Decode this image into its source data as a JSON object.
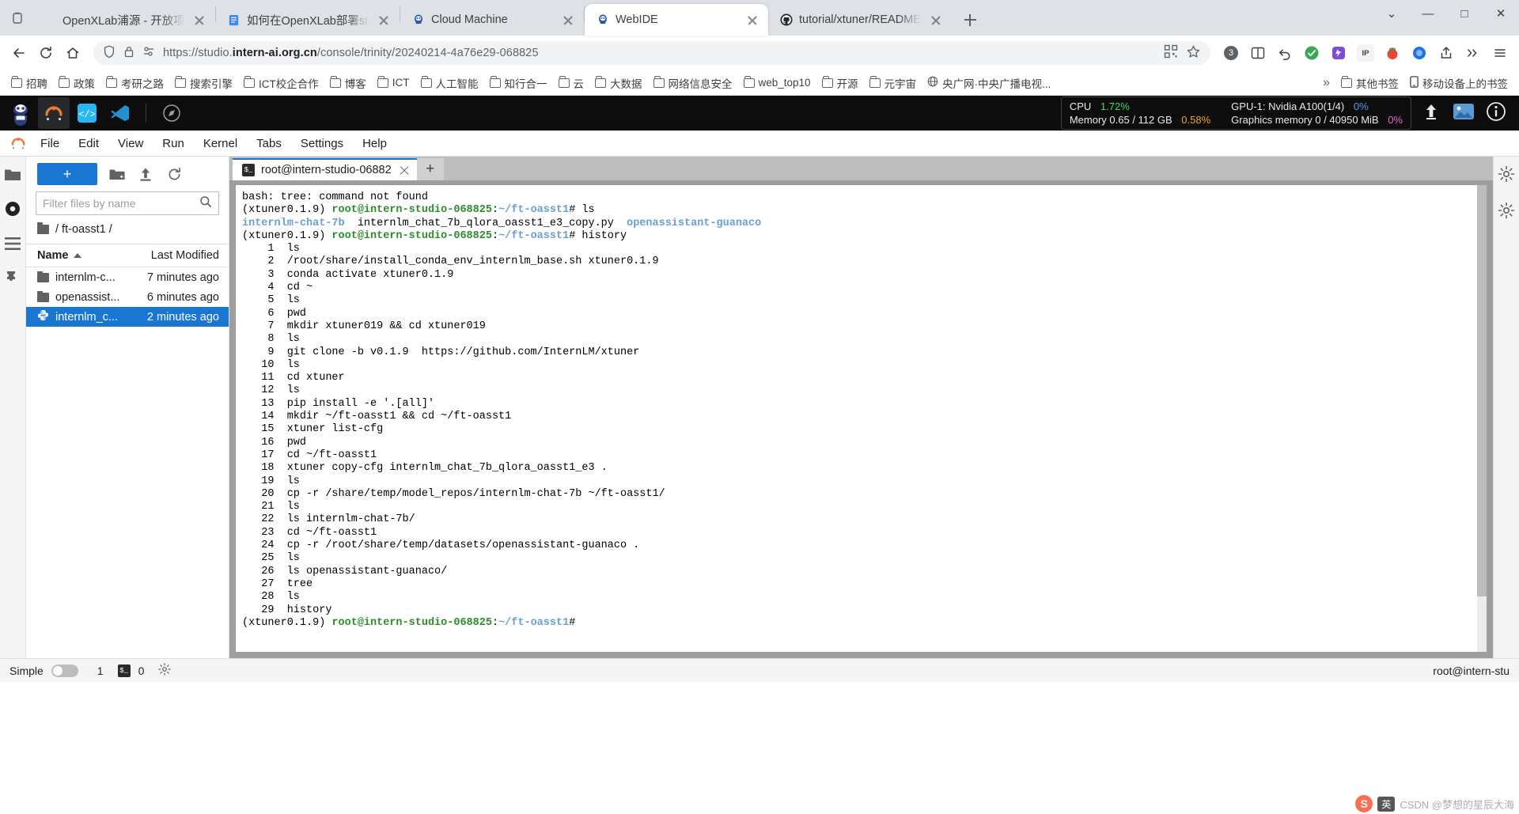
{
  "browser": {
    "tabs": [
      {
        "title": "OpenXLab浦源 - 开放项目",
        "favicon": "none",
        "active": false
      },
      {
        "title": "如何在OpenXLab部署streamli",
        "favicon": "doc-icon",
        "active": false
      },
      {
        "title": "Cloud Machine",
        "favicon": "intern-icon",
        "active": false
      },
      {
        "title": "WebIDE",
        "favicon": "intern-icon",
        "active": true
      },
      {
        "title": "tutorial/xtuner/README.md a",
        "favicon": "github-icon",
        "active": false
      }
    ],
    "new_tab_label": "+",
    "window_controls": {
      "minimize": "—",
      "maximize": "□",
      "close": "✕",
      "tab_search": "⌄"
    },
    "nav": {
      "back": "←",
      "forward": "→",
      "reload": "↻",
      "home": "⌂"
    },
    "omnibox": {
      "url_scheme": "https://studio.",
      "url_domain": "intern-ai.org.cn",
      "url_path": "/console/trinity/20240214-4a76e29-068825",
      "url_full": "https://studio.intern-ai.org.cn/console/trinity/20240214-4a76e29-068825",
      "shield_icon": "shield-icon",
      "lock_icon": "lock-icon",
      "settings_icon": "site-settings-icon",
      "qr_icon": "qr-code-icon",
      "star_icon": "bookmark-star-icon"
    },
    "toolbar_right": {
      "extension_count": "3",
      "split_icon": "split-screen-icon",
      "undo_icon": "undo-icon",
      "ext1": "green-shield-ext",
      "ext2": "purple-ext",
      "ip_label": "IP",
      "ext3": "tomato-ext",
      "ext4": "blue-circle-ext",
      "share_icon": "share-icon",
      "more_icon": "chevron-more-icon",
      "menu_icon": "browser-menu-icon"
    },
    "bookmarks": [
      {
        "label": "招聘",
        "icon": "folder-icon"
      },
      {
        "label": "政策",
        "icon": "folder-icon"
      },
      {
        "label": "考研之路",
        "icon": "folder-icon"
      },
      {
        "label": "搜索引擎",
        "icon": "folder-icon"
      },
      {
        "label": "ICT校企合作",
        "icon": "folder-icon"
      },
      {
        "label": "博客",
        "icon": "folder-icon"
      },
      {
        "label": "ICT",
        "icon": "folder-icon"
      },
      {
        "label": "人工智能",
        "icon": "folder-icon"
      },
      {
        "label": "知行合一",
        "icon": "folder-icon"
      },
      {
        "label": "云",
        "icon": "folder-icon"
      },
      {
        "label": "大数据",
        "icon": "folder-icon"
      },
      {
        "label": "网络信息安全",
        "icon": "folder-icon"
      },
      {
        "label": "web_top10",
        "icon": "folder-icon"
      },
      {
        "label": "开源",
        "icon": "folder-icon"
      },
      {
        "label": "元宇宙",
        "icon": "folder-icon"
      },
      {
        "label": "央广网·中央广播电视...",
        "icon": "globe-icon"
      }
    ],
    "bookmarks_overflow": {
      "chevron": "»",
      "other_bookmarks": "其他书签",
      "mobile_bookmarks": "移动设备上的书签"
    }
  },
  "jupyter": {
    "topbar": {
      "apps": [
        "jupyter-logo",
        "intern-studio-icon",
        "code-server-icon",
        "vscode-icon",
        "compass-icon"
      ],
      "resources": {
        "cpu_label": "CPU",
        "cpu_value": "1.72%",
        "memory_label": "Memory 0.65 / 112 GB",
        "memory_value": "0.58%",
        "gpu_label": "GPU-1: Nvidia A100(1/4)",
        "gpu_value": "0%",
        "gmem_label": "Graphics memory 0 / 40950 MiB",
        "gmem_value": "0%"
      },
      "right_icons": [
        "upload-icon",
        "image-icon",
        "info-icon"
      ]
    },
    "menubar": [
      "File",
      "Edit",
      "View",
      "Run",
      "Kernel",
      "Tabs",
      "Settings",
      "Help"
    ],
    "file_browser": {
      "new_button": "+",
      "tools": [
        "new-folder-icon",
        "upload-icon",
        "refresh-icon"
      ],
      "filter_placeholder": "Filter files by name",
      "filter_value": "",
      "breadcrumb": "/ ft-oasst1 /",
      "columns": {
        "name": "Name",
        "modified": "Last Modified"
      },
      "rows": [
        {
          "name": "internlm-c...",
          "modified": "7 minutes ago",
          "icon": "folder-icon",
          "selected": false
        },
        {
          "name": "openassist...",
          "modified": "6 minutes ago",
          "icon": "folder-icon",
          "selected": false
        },
        {
          "name": "internlm_c...",
          "modified": "2 minutes ago",
          "icon": "python-icon",
          "selected": true
        }
      ]
    },
    "terminal": {
      "tab_title": "root@intern-studio-06882",
      "tab_icon": "terminal-icon",
      "add_tab": "+",
      "lines": [
        [
          {
            "t": "bash: tree: command not found",
            "c": "plain"
          }
        ],
        [
          {
            "t": "(xtuner0.1.9) ",
            "c": "plain"
          },
          {
            "t": "root@intern-studio-068825",
            "c": "green"
          },
          {
            "t": ":",
            "c": "plain"
          },
          {
            "t": "~/ft-oasst1",
            "c": "blue"
          },
          {
            "t": "# ls",
            "c": "plain"
          }
        ],
        [
          {
            "t": "internlm-chat-7b",
            "c": "blue"
          },
          {
            "t": "  internlm_chat_7b_qlora_oasst1_e3_copy.py  ",
            "c": "plain"
          },
          {
            "t": "openassistant-guanaco",
            "c": "blue"
          }
        ],
        [
          {
            "t": "(xtuner0.1.9) ",
            "c": "plain"
          },
          {
            "t": "root@intern-studio-068825",
            "c": "green"
          },
          {
            "t": ":",
            "c": "plain"
          },
          {
            "t": "~/ft-oasst1",
            "c": "blue"
          },
          {
            "t": "# history",
            "c": "plain"
          }
        ],
        [
          {
            "t": "    1  ls",
            "c": "plain"
          }
        ],
        [
          {
            "t": "    2  /root/share/install_conda_env_internlm_base.sh xtuner0.1.9",
            "c": "plain"
          }
        ],
        [
          {
            "t": "    3  conda activate xtuner0.1.9",
            "c": "plain"
          }
        ],
        [
          {
            "t": "    4  cd ~",
            "c": "plain"
          }
        ],
        [
          {
            "t": "    5  ls",
            "c": "plain"
          }
        ],
        [
          {
            "t": "    6  pwd",
            "c": "plain"
          }
        ],
        [
          {
            "t": "    7  mkdir xtuner019 && cd xtuner019",
            "c": "plain"
          }
        ],
        [
          {
            "t": "    8  ls",
            "c": "plain"
          }
        ],
        [
          {
            "t": "    9  git clone -b v0.1.9  https://github.com/InternLM/xtuner",
            "c": "plain"
          }
        ],
        [
          {
            "t": "   10  ls",
            "c": "plain"
          }
        ],
        [
          {
            "t": "   11  cd xtuner",
            "c": "plain"
          }
        ],
        [
          {
            "t": "   12  ls",
            "c": "plain"
          }
        ],
        [
          {
            "t": "   13  pip install -e '.[all]'",
            "c": "plain"
          }
        ],
        [
          {
            "t": "   14  mkdir ~/ft-oasst1 && cd ~/ft-oasst1",
            "c": "plain"
          }
        ],
        [
          {
            "t": "   15  xtuner list-cfg",
            "c": "plain"
          }
        ],
        [
          {
            "t": "   16  pwd",
            "c": "plain"
          }
        ],
        [
          {
            "t": "   17  cd ~/ft-oasst1",
            "c": "plain"
          }
        ],
        [
          {
            "t": "   18  xtuner copy-cfg internlm_chat_7b_qlora_oasst1_e3 .",
            "c": "plain"
          }
        ],
        [
          {
            "t": "   19  ls",
            "c": "plain"
          }
        ],
        [
          {
            "t": "   20  cp -r /share/temp/model_repos/internlm-chat-7b ~/ft-oasst1/",
            "c": "plain"
          }
        ],
        [
          {
            "t": "   21  ls",
            "c": "plain"
          }
        ],
        [
          {
            "t": "   22  ls internlm-chat-7b/",
            "c": "plain"
          }
        ],
        [
          {
            "t": "   23  cd ~/ft-oasst1",
            "c": "plain"
          }
        ],
        [
          {
            "t": "   24  cp -r /root/share/temp/datasets/openassistant-guanaco .",
            "c": "plain"
          }
        ],
        [
          {
            "t": "   25  ls",
            "c": "plain"
          }
        ],
        [
          {
            "t": "   26  ls openassistant-guanaco/",
            "c": "plain"
          }
        ],
        [
          {
            "t": "   27  tree",
            "c": "plain"
          }
        ],
        [
          {
            "t": "   28  ls",
            "c": "plain"
          }
        ],
        [
          {
            "t": "   29  history",
            "c": "plain"
          }
        ],
        [
          {
            "t": "(xtuner0.1.9) ",
            "c": "plain"
          },
          {
            "t": "root@intern-studio-068825",
            "c": "green"
          },
          {
            "t": ":",
            "c": "plain"
          },
          {
            "t": "~/ft-oasst1",
            "c": "blue"
          },
          {
            "t": "#",
            "c": "plain"
          }
        ]
      ]
    },
    "right_rail": [
      "settings-icon",
      "extension-icon"
    ],
    "left_rail": [
      "folder-icon",
      "running-icon",
      "commands-icon",
      "extensions-icon"
    ],
    "status_bar": {
      "mode_label": "Simple",
      "toggle_state": "off",
      "kernel_count": "1",
      "terminal_icon": "terminal-icon",
      "terminal_count": "0",
      "settings_icon": "gear-icon",
      "user": "root@intern-stu"
    }
  },
  "watermark": {
    "site": "CSDN @梦想的星辰大海",
    "ime_lang": "英",
    "ime_icons": "☺ ⌨ ⓘ"
  },
  "colors": {
    "accent_blue": "#1976d2",
    "chrome_bg": "#dee1e6",
    "jl_dark": "#0d0d0d",
    "terminal_green": "#2e8b2e",
    "terminal_blue": "#6a9fd4",
    "cpu_green": "#3ddc5b",
    "mem_orange": "#f5a623",
    "gpu_blue": "#4f9dea",
    "gmem_pink": "#e06ec0"
  }
}
